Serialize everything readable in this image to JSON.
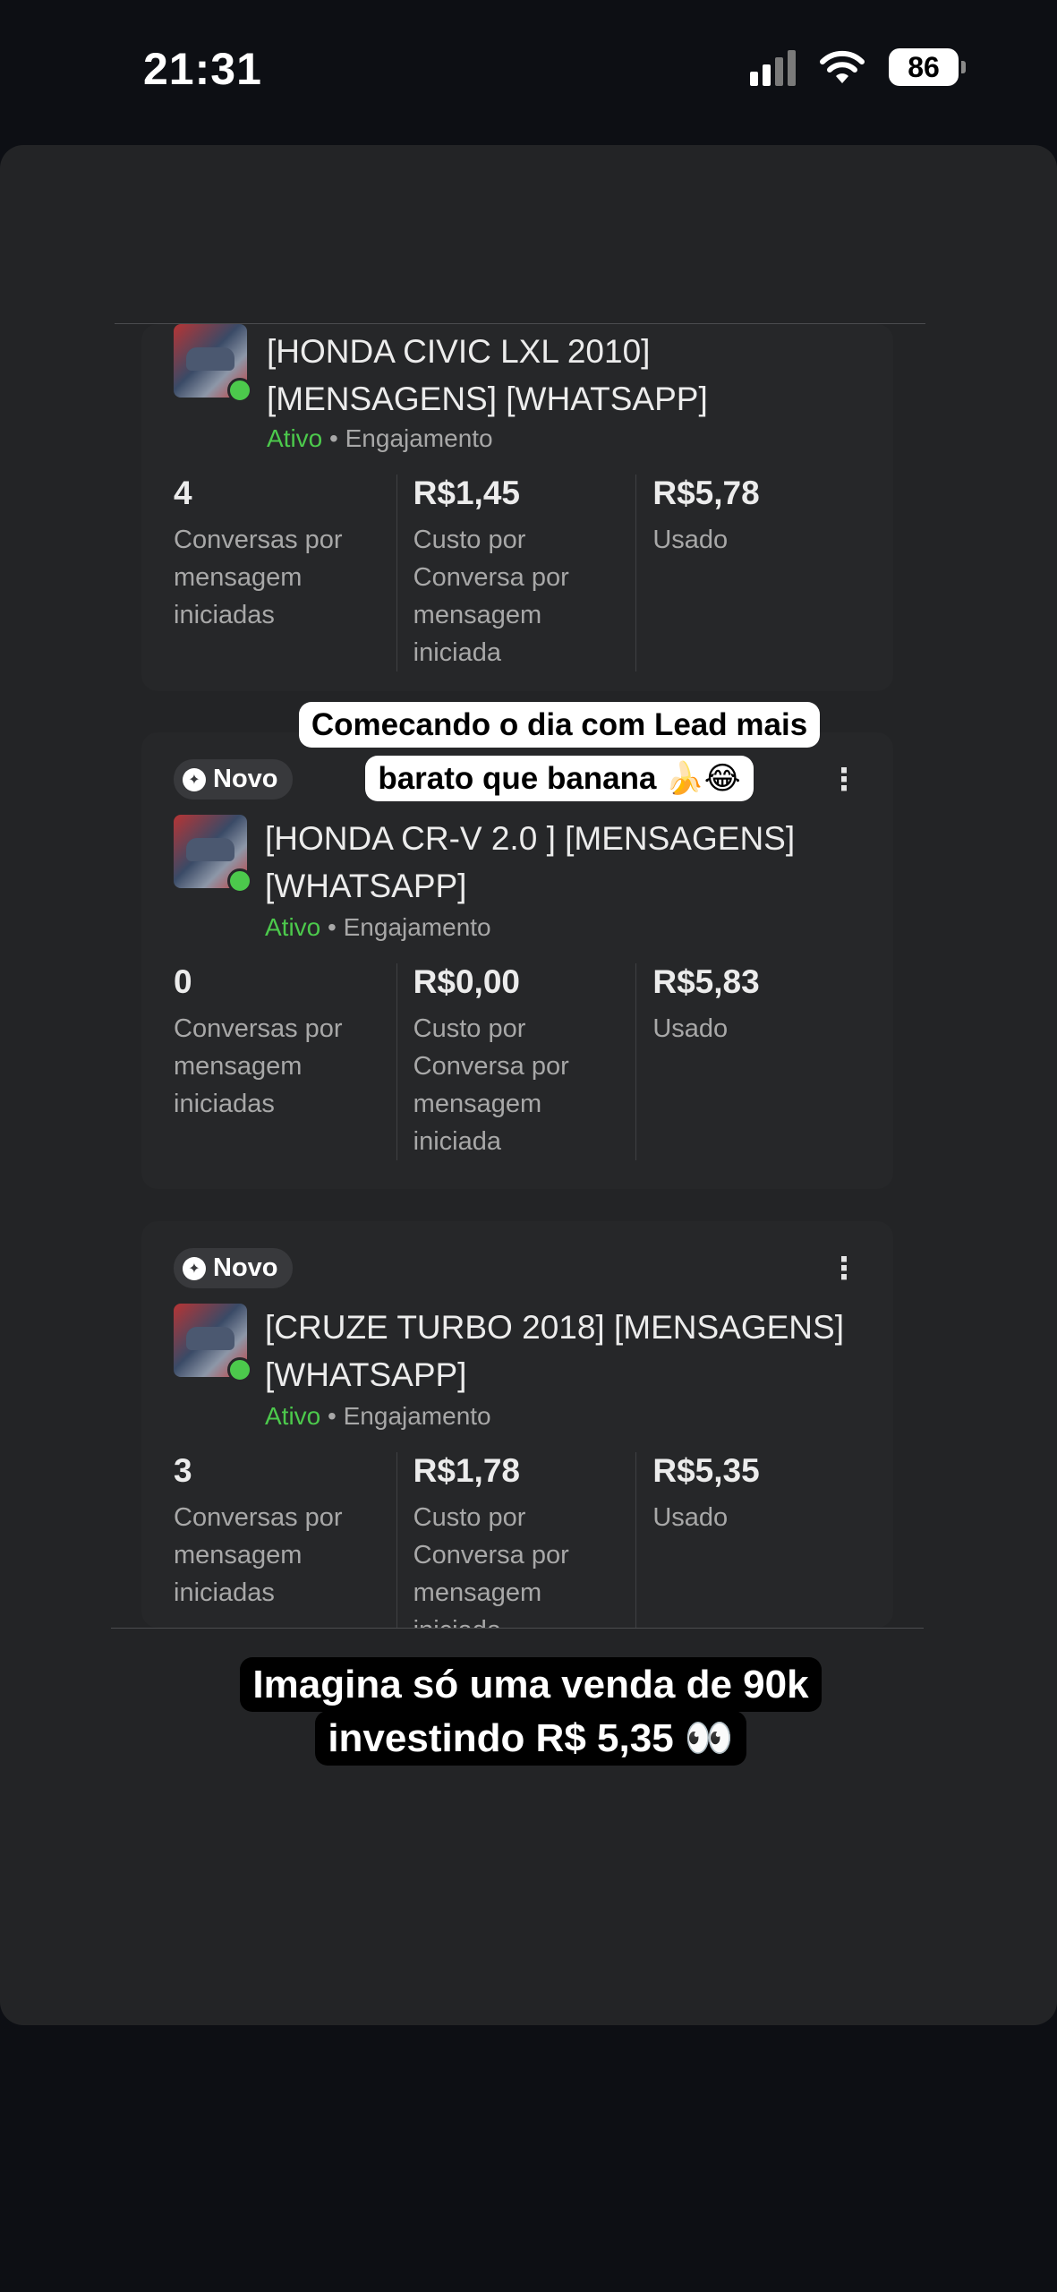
{
  "status_bar": {
    "time": "21:31",
    "battery": "86"
  },
  "overlay_text": {
    "caption_top": "Comecando o dia com Lead mais barato que banana 🍌😂",
    "caption_bottom": "Imagina só uma venda de 90k investindo R$ 5,35 👀"
  },
  "cards": [
    {
      "badge": "",
      "title": "[HONDA CIVIC LXL 2010] [MENSAGENS] [WHATSAPP]",
      "status": "Ativo",
      "category": "Engajamento",
      "metrics": [
        {
          "value": "4",
          "label": "Conversas por mensagem iniciadas"
        },
        {
          "value": "R$1,45",
          "label": "Custo por Conversa por mensagem iniciada"
        },
        {
          "value": "R$5,78",
          "label": "Usado"
        }
      ]
    },
    {
      "badge": "Novo",
      "title": "[HONDA CR-V 2.0 ] [MENSAGENS] [WHATSAPP]",
      "status": "Ativo",
      "category": "Engajamento",
      "metrics": [
        {
          "value": "0",
          "label": "Conversas por mensagem iniciadas"
        },
        {
          "value": "R$0,00",
          "label": "Custo por Conversa por mensagem iniciada"
        },
        {
          "value": "R$5,83",
          "label": "Usado"
        }
      ]
    },
    {
      "badge": "Novo",
      "title": "[CRUZE TURBO 2018] [MENSAGENS] [WHATSAPP]",
      "status": "Ativo",
      "category": "Engajamento",
      "metrics": [
        {
          "value": "3",
          "label": "Conversas por mensagem iniciadas"
        },
        {
          "value": "R$1,78",
          "label": "Custo por Conversa por mensagem iniciada"
        },
        {
          "value": "R$5,35",
          "label": "Usado"
        }
      ]
    }
  ],
  "separator": "•",
  "icons": {
    "more": "more-vertical-icon",
    "badge": "new-badge-icon"
  },
  "colors": {
    "active": "#4cc94c",
    "panel": "#232426",
    "background": "#0d0f14"
  }
}
